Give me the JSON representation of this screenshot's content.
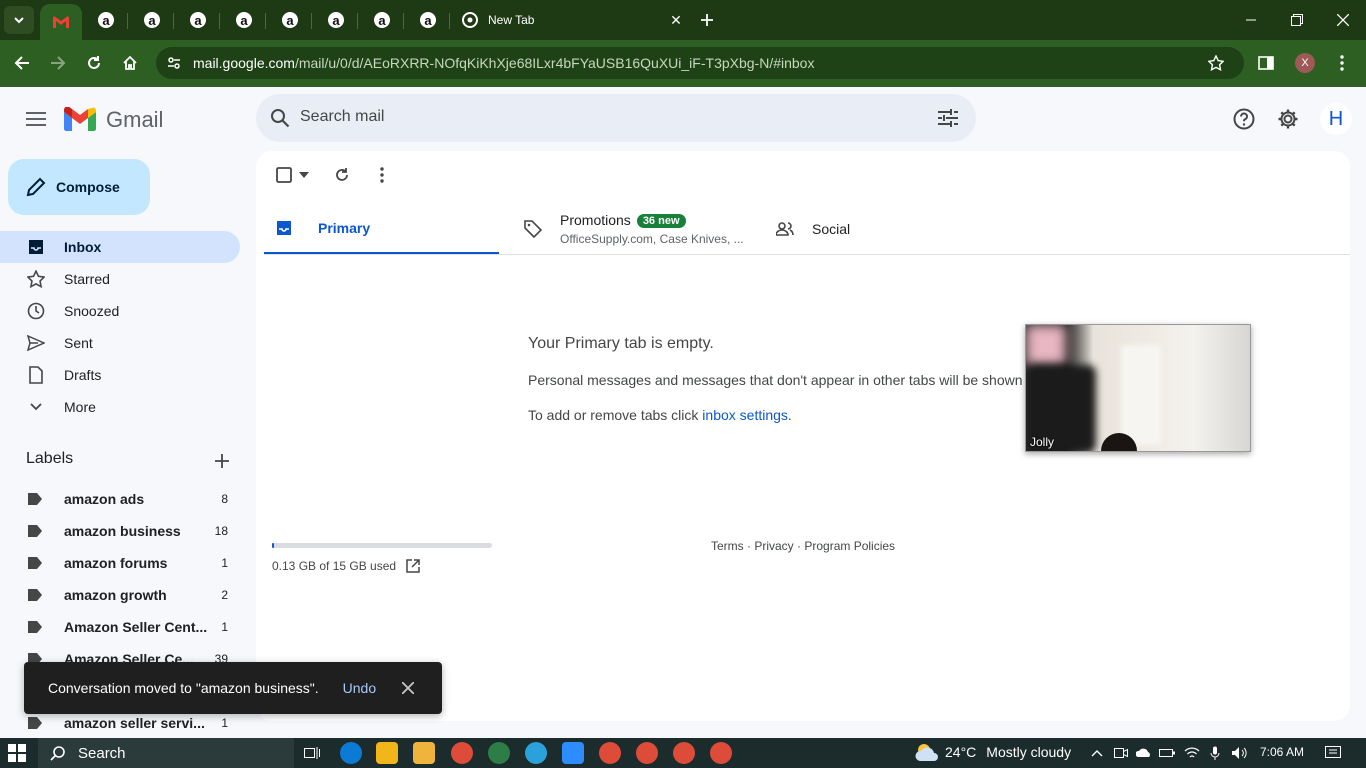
{
  "browser": {
    "new_tab_title": "New Tab",
    "url_domain": "mail.google.com",
    "url_path": "/mail/u/0/d/AEoRXRR-NOfqKiKhXje68ILxr4bFYaUSB16QuXUi_iF-T3pXbg-N/#inbox",
    "profile_initial": "X",
    "amazon_tab_glyph": "a"
  },
  "gmail": {
    "logo_text": "Gmail",
    "search_placeholder": "Search mail",
    "avatar_initial": "H",
    "compose_label": "Compose"
  },
  "nav": {
    "items": [
      {
        "label": "Inbox",
        "icon": "inbox-icon"
      },
      {
        "label": "Starred",
        "icon": "star-icon"
      },
      {
        "label": "Snoozed",
        "icon": "clock-icon"
      },
      {
        "label": "Sent",
        "icon": "send-icon"
      },
      {
        "label": "Drafts",
        "icon": "draft-icon"
      },
      {
        "label": "More",
        "icon": "chevron-down-icon"
      }
    ]
  },
  "labels": {
    "heading": "Labels",
    "items": [
      {
        "name": "amazon ads",
        "count": "8"
      },
      {
        "name": "amazon business",
        "count": "18"
      },
      {
        "name": "amazon forums",
        "count": "1"
      },
      {
        "name": "amazon growth",
        "count": "2"
      },
      {
        "name": "Amazon Seller Cent...",
        "count": "1"
      },
      {
        "name": "Amazon Seller Ce...",
        "count": "39"
      },
      {
        "name": "",
        "count": ""
      },
      {
        "name": "amazon seller servi...",
        "count": "1"
      }
    ]
  },
  "tabs": {
    "primary": "Primary",
    "promotions": "Promotions",
    "promotions_badge": "36 new",
    "promotions_sub": "OfficeSupply.com, Case Knives, ...",
    "social": "Social"
  },
  "empty": {
    "title": "Your Primary tab is empty.",
    "description": "Personal messages and messages that don't appear in other tabs will be shown here.",
    "hint_prefix": "To add or remove tabs click ",
    "hint_link": "inbox settings",
    "hint_suffix": "."
  },
  "storage": {
    "text": "0.13 GB of 15 GB used",
    "fraction": 0.009
  },
  "footer": {
    "terms": "Terms",
    "privacy": "Privacy",
    "policies": "Program Policies",
    "sep": " · "
  },
  "video": {
    "participant": "Jolly"
  },
  "snackbar": {
    "message": "Conversation moved to \"amazon business\".",
    "undo": "Undo"
  },
  "taskbar": {
    "search": "Search",
    "temperature": "24°C",
    "weather": "Mostly cloudy",
    "time": "7:06 AM"
  }
}
